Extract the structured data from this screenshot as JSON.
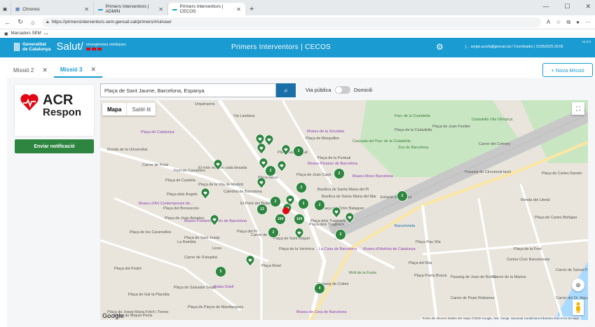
{
  "browser": {
    "tabs": [
      {
        "label": "Chronos"
      },
      {
        "label": "Primers Interventors | ADMIN"
      },
      {
        "label": "Primers Interventors | CECOS"
      }
    ],
    "url": "https://primersinterventors.sem.gencat.cat/primers/#/ui/user",
    "bookmark": "Marcadors SEM"
  },
  "header": {
    "brand_line1": "Generalitat",
    "brand_line2": "de Catalunya",
    "salut": "Salut/",
    "sem_line1": "emergències mèdiques",
    "title": "Primers Interventors | CECOS",
    "user": "[→ sergio.acorfa@gencat.cat / Coordinador   |   21/05/2025 20:05",
    "version": "v1.0.0",
    "colors": {
      "header_bg": "#1a9bd1",
      "accent": "#2e8540"
    }
  },
  "subtabs": [
    {
      "label": "Missió 2",
      "active": false
    },
    {
      "label": "Missió 3",
      "active": true
    }
  ],
  "new_mission_label": "+ Nova Missió",
  "logo": {
    "line1": "ACR",
    "line2": "Respon"
  },
  "send_notification_label": "Enviar notificació",
  "search": {
    "value": "Plaça de Sant Jaume, Barcelona, Espanya"
  },
  "toggle": {
    "left_label": "Via pública",
    "right_label": "Domicili"
  },
  "map": {
    "type_buttons": [
      "Mapa",
      "Satèl·lit"
    ],
    "google": "Google",
    "attribution": "Tecles de drecera   Dades del mapa ©2025 Google, Inst. Geogr. Nacional   Condicions   Informeu d'un error al mapa",
    "labels": [
      "Urquinaona",
      "Plaça de Catalunya",
      "Ronda de la Universitat",
      "Carrer de Pelai",
      "Font de Canaletes",
      "El món neix en cada besada",
      "Plaça de la Vila de Madrid",
      "Plaça de Castella",
      "Plaça dels Àngels",
      "Plaça del Bonsuccés",
      "Museu d'Art Contemporani de...",
      "Plaça de Joan Amades",
      "Plaça de les Caramelles",
      "Museu Frederic Marès de Barcelona",
      "Plaça de Sant Josep",
      "Liceu",
      "Carrer de l'Hospital",
      "Plaça del Pedró",
      "Palau Güell",
      "Plaça de Salvador Seguí",
      "Plaça de Pieyre de Mandiargues",
      "Plaça de Miquel Peiris",
      "Museu de la Xocolata",
      "Plaça de Marquilles",
      "Plaça Sant Cugat",
      "Plaça de la Puntual",
      "Museu Picasso de Barcelona",
      "Plaça de Joan Capri",
      "Plaça Nova",
      "Catedral de Barcelona",
      "El Point del Bisbe",
      "Basílica de Santa Maria del Pi",
      "Plaça del Pi",
      "Plaça Reial",
      "Museu Moco Barcelona",
      "Basílica de Santa Maria del Mar",
      "Estació de França",
      "Plaça de Víctor Balaguer",
      "Plaça dels Traginers",
      "Plaça de Sant Miquel",
      "Plaça de la Verònica",
      "La Casa de Barcelona",
      "Museu d'Història de Catalunya",
      "Moll de la Fusta",
      "Barceloneta",
      "Plaça Pau Vila",
      "Plaça del Mar",
      "Plaça Poeta Boscà",
      "Centre Cívic Barceloneta",
      "Plaça de la Font",
      "Plaça de Carles Bohigas",
      "Parc de la Ciutadella",
      "Zoo de Barcelona",
      "Plaça de Joan Fiveller",
      "Cascada del Parc de la Ciutadella",
      "Plaça de la Ciutadella",
      "Ciutadella Vila Olímpica",
      "Plaça de Carles Darwin",
      "Passeig de Circumval·lació",
      "Ronda del Litoral",
      "Carrer del Comerç",
      "Via Laietana",
      "Carrer de Ferran",
      "La Rambla",
      "Passeig de Colom",
      "Passeig de Joan de Borbó",
      "Carrer de la Marina",
      "Carrer del Dr. Aiguader",
      "Carrer de Pepe Rubianes",
      "Carrer de Salvat-Papasseit",
      "Plaça de Gal·la Placídia",
      "Museu de Cera de Barcelona",
      "Plaça dels Traginers",
      "Plaça de Josep Maria Folch i Torres"
    ],
    "clusters": [
      {
        "count": "3"
      },
      {
        "count": "2"
      },
      {
        "count": "2"
      },
      {
        "count": "2"
      },
      {
        "count": "2"
      },
      {
        "count": "13"
      },
      {
        "count": "3"
      },
      {
        "count": "2"
      },
      {
        "count": "104"
      },
      {
        "count": "104"
      },
      {
        "count": "2"
      },
      {
        "count": "2"
      },
      {
        "count": "5"
      },
      {
        "count": "4"
      },
      {
        "count": "2"
      }
    ]
  }
}
